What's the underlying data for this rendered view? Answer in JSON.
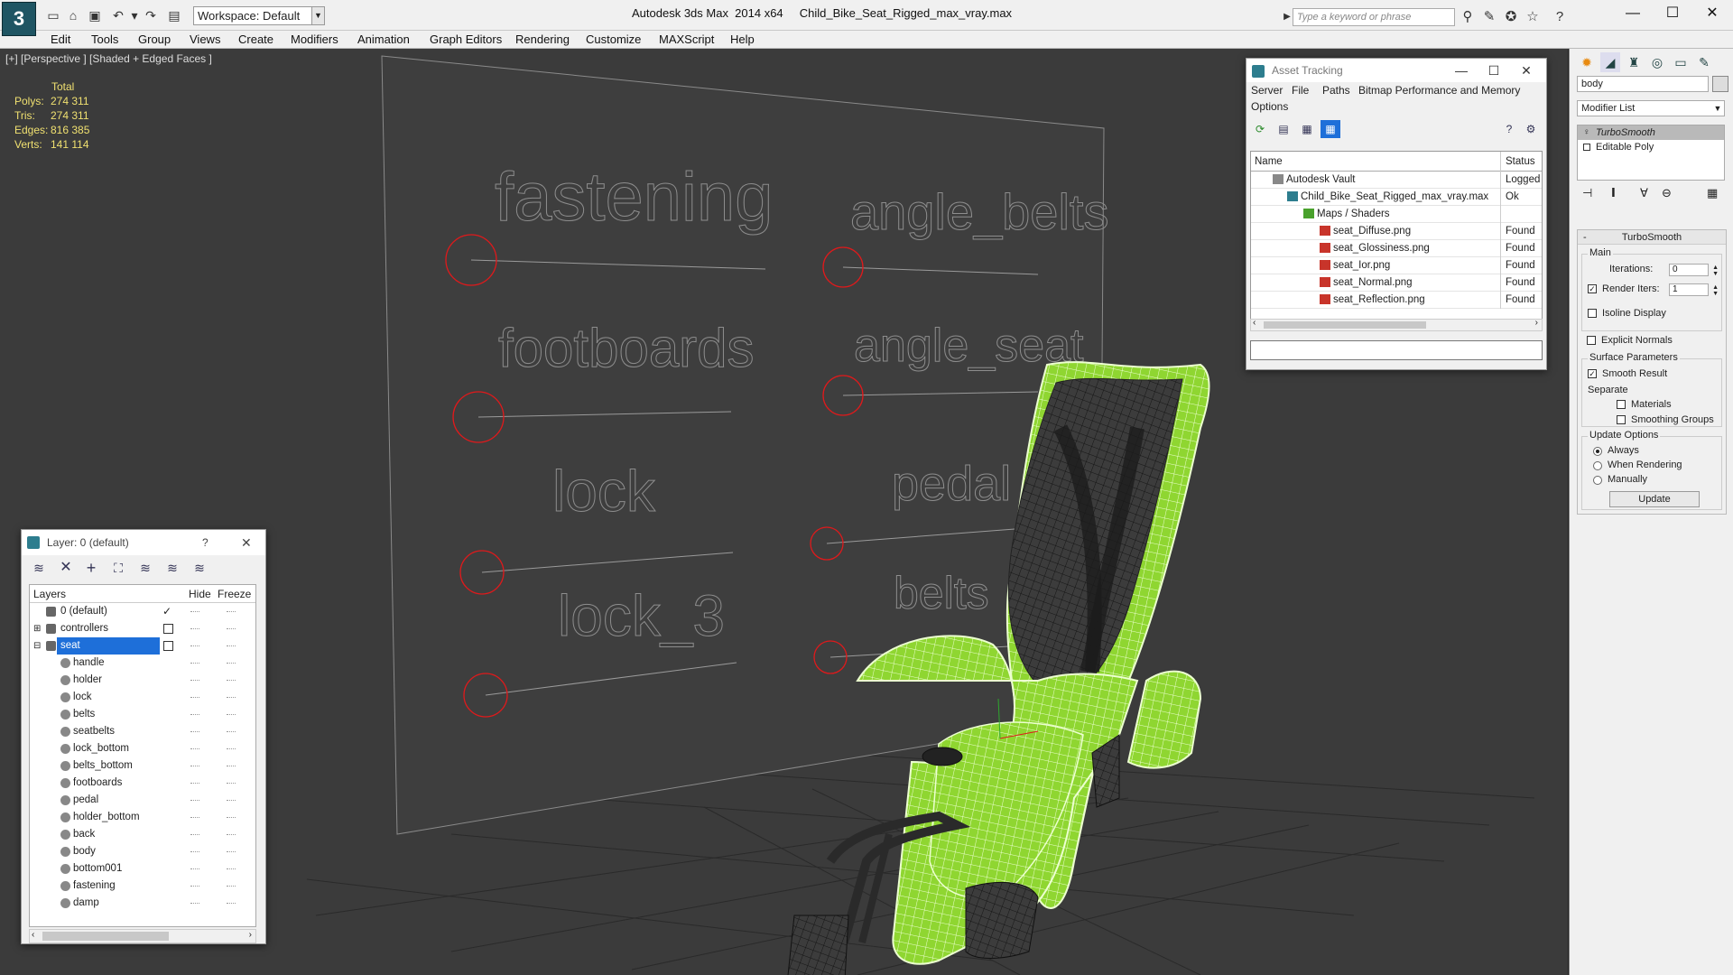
{
  "app": {
    "title": "Autodesk 3ds Max  2014 x64     Child_Bike_Seat_Rigged_max_vray.max",
    "workspace": "Workspace: Default",
    "search_placeholder": "Type a keyword or phrase",
    "menu": [
      "Edit",
      "Tools",
      "Group",
      "Views",
      "Create",
      "Modifiers",
      "Animation",
      "Graph Editors",
      "Rendering",
      "Customize",
      "MAXScript",
      "Help"
    ]
  },
  "viewport": {
    "label": "[+] [Perspective ] [Shaded + Edged Faces ]",
    "stats": {
      "header": "Total",
      "rows": [
        {
          "label": "Polys:",
          "value": "274 311"
        },
        {
          "label": "Tris:",
          "value": "274 311"
        },
        {
          "label": "Edges:",
          "value": "816 385"
        },
        {
          "label": "Verts:",
          "value": "141 114"
        }
      ]
    },
    "controllers": [
      "fastening",
      "angle_belts",
      "footboards",
      "angle_seat",
      "lock",
      "pedal",
      "lock_3",
      "belts"
    ]
  },
  "layer_window": {
    "title": "Layer: 0 (default)",
    "help": "?",
    "columns": {
      "layers": "Layers",
      "hide": "Hide",
      "freeze": "Freeze"
    },
    "layers": [
      "0 (default)",
      "controllers",
      "seat"
    ],
    "children": [
      "handle",
      "holder",
      "lock",
      "belts",
      "seatbelts",
      "lock_bottom",
      "belts_bottom",
      "footboards",
      "pedal",
      "holder_bottom",
      "back",
      "body",
      "bottom001",
      "fastening",
      "damp"
    ]
  },
  "asset_window": {
    "title": "Asset Tracking",
    "menu_row1": [
      "Server",
      "File",
      "Paths",
      "Bitmap Performance and Memory"
    ],
    "menu_row2": [
      "Options"
    ],
    "columns": {
      "name": "Name",
      "status": "Status"
    },
    "rows": [
      {
        "name": "Autodesk Vault",
        "status": "Logged O"
      },
      {
        "name": "Child_Bike_Seat_Rigged_max_vray.max",
        "status": "Ok"
      },
      {
        "name": "Maps / Shaders",
        "status": ""
      },
      {
        "name": "seat_Diffuse.png",
        "status": "Found"
      },
      {
        "name": "seat_Glossiness.png",
        "status": "Found"
      },
      {
        "name": "seat_Ior.png",
        "status": "Found"
      },
      {
        "name": "seat_Normal.png",
        "status": "Found"
      },
      {
        "name": "seat_Reflection.png",
        "status": "Found"
      }
    ]
  },
  "command_panel": {
    "object_name": "body",
    "modifier_list": "Modifier List",
    "stack": [
      "TurboSmooth",
      "Editable Poly"
    ],
    "rollout_title": "TurboSmooth",
    "main_label": "Main",
    "iterations_label": "Iterations:",
    "iterations": "0",
    "render_iters_label": "Render Iters:",
    "render_iters": "1",
    "isoline": "Isoline Display",
    "explicit_normals": "Explicit Normals",
    "surface_label": "Surface Parameters",
    "smooth_result": "Smooth Result",
    "separate_label": "Separate",
    "materials": "Materials",
    "smoothing_groups": "Smoothing Groups",
    "update_label": "Update Options",
    "always": "Always",
    "when_rendering": "When Rendering",
    "manually": "Manually",
    "update_button": "Update"
  },
  "colors": {
    "accent": "#1e6fd9",
    "wire": "#a6e84a",
    "controller": "#e0191b"
  }
}
